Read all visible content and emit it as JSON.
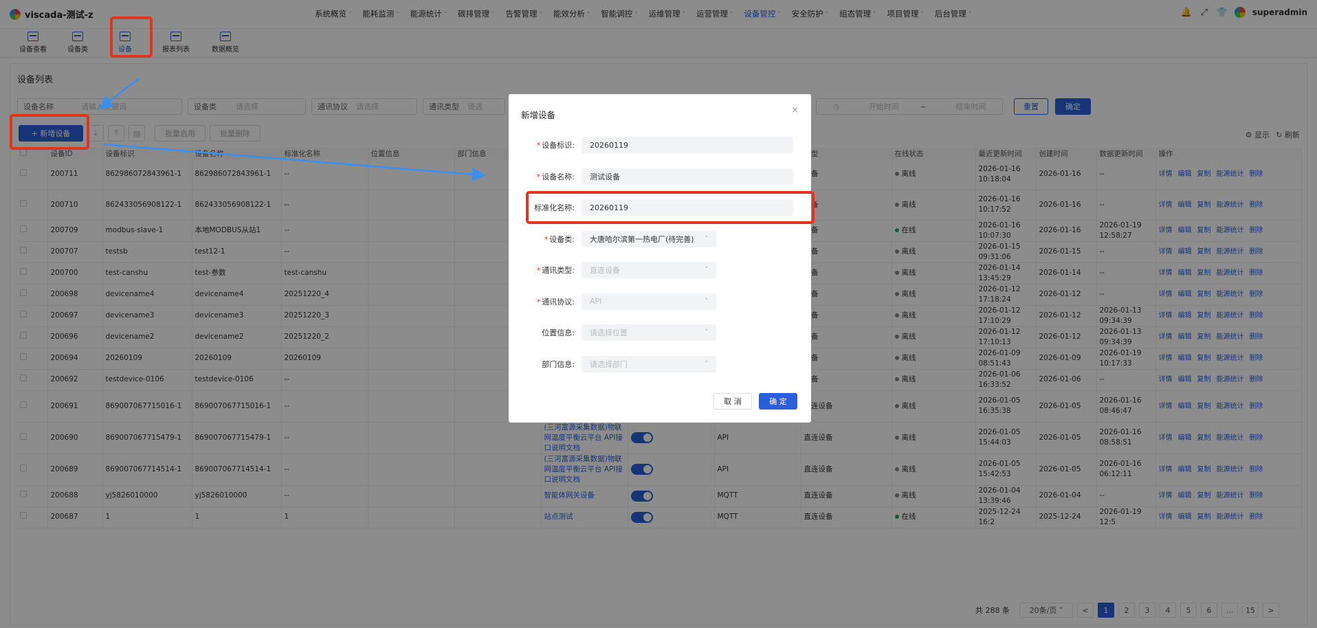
{
  "app": {
    "title": "viscada-测试-z",
    "user": "superadmin"
  },
  "nav": [
    "系统概览",
    "能耗监测",
    "能源统计",
    "碳排管理",
    "告警管理",
    "能效分析",
    "智能调控",
    "运维管理",
    "运营管理",
    "设备管控",
    "安全防护",
    "组态管理",
    "项目管理",
    "后台管理"
  ],
  "subnav": [
    "设备查看",
    "设备类",
    "设备",
    "报表列表",
    "数据概览"
  ],
  "page": {
    "title": "设备列表",
    "filters": {
      "device_name_label": "设备名称",
      "device_name_ph": "请输入关键词",
      "device_type_label": "设备类",
      "device_type_ph": "请选择",
      "protocol_label": "通讯协议",
      "protocol_ph": "请选择",
      "comm_type_label": "通讯类型",
      "comm_type_ph": "请选",
      "start_ph": "开始时间",
      "tilde": "~",
      "end_ph": "结束时间",
      "reset": "重置",
      "confirm": "确定"
    },
    "toolbar": {
      "add": "+ 新增设备",
      "batch_enable": "批量启用",
      "batch_delete": "批量删除",
      "display": "显示",
      "refresh": "刷新"
    },
    "columns": [
      "",
      "设备ID",
      "设备标识",
      "设备名称",
      "标准化名称",
      "位置信息",
      "部门信息",
      "",
      "",
      "",
      "类型",
      "在线状态",
      "最近更新时间",
      "创建时间",
      "数据更新时间",
      "操作"
    ],
    "rows": [
      {
        "id": "200711",
        "ident": "862986072843961-1",
        "name": "862986072843961-1",
        "std": "--",
        "dept": "",
        "proto": "",
        "type": "设备",
        "status": "离线",
        "online": false,
        "last": "2026-01-16 10:18:04",
        "created": "2026-01-16",
        "data": "--"
      },
      {
        "id": "200710",
        "ident": "862433056908122-1",
        "name": "862433056908122-1",
        "std": "--",
        "dept": "",
        "proto": "",
        "type": "设备",
        "status": "离线",
        "online": false,
        "last": "2026-01-16 10:17:52",
        "created": "2026-01-16",
        "data": "--"
      },
      {
        "id": "200709",
        "ident": "modbus-slave-1",
        "name": "本地MODBUS从站1",
        "std": "--",
        "dept": "",
        "proto": "",
        "type": "设备",
        "status": "在线",
        "online": true,
        "last": "2026-01-16 10:07:30",
        "created": "2026-01-16",
        "data": "2026-01-19 12:58:27"
      },
      {
        "id": "200707",
        "ident": "testsb",
        "name": "test12-1",
        "std": "--",
        "dept": "",
        "proto": "",
        "type": "设备",
        "status": "离线",
        "online": false,
        "last": "2026-01-15 09:31:06",
        "created": "2026-01-15",
        "data": "--"
      },
      {
        "id": "200700",
        "ident": "test-canshu",
        "name": "test-参数",
        "std": "test-canshu",
        "dept": "",
        "proto": "",
        "type": "设备",
        "status": "离线",
        "online": false,
        "last": "2026-01-14 13:45:29",
        "created": "2026-01-14",
        "data": "--"
      },
      {
        "id": "200698",
        "ident": "devicename4",
        "name": "devicename4",
        "std": "20251220_4",
        "dept": "",
        "proto": "",
        "type": "设备",
        "status": "离线",
        "online": false,
        "last": "2026-01-12 17:18:24",
        "created": "2026-01-12",
        "data": "--"
      },
      {
        "id": "200697",
        "ident": "devicename3",
        "name": "devicename3",
        "std": "20251220_3",
        "dept": "",
        "proto": "",
        "type": "设备",
        "status": "离线",
        "online": false,
        "last": "2026-01-12 17:10:29",
        "created": "2026-01-12",
        "data": "2026-01-13 09:34:39"
      },
      {
        "id": "200696",
        "ident": "devicename2",
        "name": "devicename2",
        "std": "20251220_2",
        "dept": "",
        "proto": "",
        "type": "设备",
        "status": "离线",
        "online": false,
        "last": "2026-01-12 17:10:13",
        "created": "2026-01-12",
        "data": "2026-01-13 09:34:39"
      },
      {
        "id": "200694",
        "ident": "20260109",
        "name": "20260109",
        "std": "20260109",
        "dept": "",
        "proto": "",
        "type": "设备",
        "status": "离线",
        "online": false,
        "last": "2026-01-09 08:51:43",
        "created": "2026-01-09",
        "data": "2026-01-19 10:17:33"
      },
      {
        "id": "200692",
        "ident": "testdevice-0106",
        "name": "testdevice-0106",
        "std": "--",
        "dept": "",
        "proto": "",
        "type": "设备",
        "status": "离线",
        "online": false,
        "last": "2026-01-06 16:33:52",
        "created": "2026-01-06",
        "data": "--"
      },
      {
        "id": "200691",
        "ident": "869007067715016-1",
        "name": "869007067715016-1",
        "std": "--",
        "dept": "(三河富源采集数据)物联网温度平衡云平台 API接口说明文档",
        "proto": "API",
        "type": "直连设备",
        "status": "离线",
        "online": false,
        "last": "2026-01-05 16:35:38",
        "created": "2026-01-05",
        "data": "2026-01-16 08:46:47"
      },
      {
        "id": "200690",
        "ident": "869007067715479-1",
        "name": "869007067715479-1",
        "std": "--",
        "dept": "(三河富源采集数据)物联网温度平衡云平台 API接口说明文档",
        "proto": "API",
        "type": "直连设备",
        "status": "离线",
        "online": false,
        "last": "2026-01-05 15:44:03",
        "created": "2026-01-05",
        "data": "2026-01-16 08:58:51"
      },
      {
        "id": "200689",
        "ident": "869007067714514-1",
        "name": "869007067714514-1",
        "std": "--",
        "dept": "(三河富源采集数据)物联网温度平衡云平台 API接口说明文档",
        "proto": "API",
        "type": "直连设备",
        "status": "离线",
        "online": false,
        "last": "2026-01-05 15:42:53",
        "created": "2026-01-05",
        "data": "2026-01-16 06:12:11"
      },
      {
        "id": "200688",
        "ident": "yj5826010000",
        "name": "yj5826010000",
        "std": "--",
        "dept": "智能体网关设备",
        "proto": "MQTT",
        "type": "直连设备",
        "status": "离线",
        "online": false,
        "last": "2026-01-04 13:39:46",
        "created": "2026-01-04",
        "data": "--"
      },
      {
        "id": "200687",
        "ident": "1",
        "name": "1",
        "std": "1",
        "dept": "站点测试",
        "proto": "MQTT",
        "type": "直连设备",
        "status": "在线",
        "online": true,
        "last": "2025-12-24 16:2",
        "created": "2025-12-24",
        "data": "2026-01-19 12:5"
      }
    ],
    "ops": [
      "详情",
      "编辑",
      "复制",
      "能源统计",
      "删除"
    ],
    "pager": {
      "total": "共 288 条",
      "size": "20条/页",
      "pages": [
        "1",
        "2",
        "3",
        "4",
        "5",
        "6",
        "...",
        "15"
      ],
      "prev": "<",
      "next": ">"
    }
  },
  "modal": {
    "title": "新增设备",
    "close": "×",
    "fields": [
      {
        "label": "设备标识:",
        "required": true,
        "value": "20260119",
        "type": "input"
      },
      {
        "label": "设备名称:",
        "required": true,
        "value": "测试设备",
        "type": "input"
      },
      {
        "label": "标准化名称:",
        "required": false,
        "value": "20260119",
        "type": "input"
      },
      {
        "label": "设备类:",
        "required": true,
        "value": "大唐哈尔滨第一热电厂(待完善)",
        "type": "select"
      },
      {
        "label": "通讯类型:",
        "required": true,
        "value": "直连设备",
        "type": "select-dis"
      },
      {
        "label": "通讯协议:",
        "required": true,
        "value": "API",
        "type": "select-dis"
      },
      {
        "label": "位置信息:",
        "required": false,
        "value": "请选择位置",
        "type": "select-dis"
      },
      {
        "label": "部门信息:",
        "required": false,
        "value": "请选择部门",
        "type": "select-dis"
      }
    ],
    "cancel": "取 消",
    "ok": "确 定"
  },
  "colors": {
    "primary": "#2b5fd9",
    "highlight": "#e0341f",
    "arrow": "#3b8ff0",
    "online": "#27ae60",
    "offline": "#888888"
  }
}
